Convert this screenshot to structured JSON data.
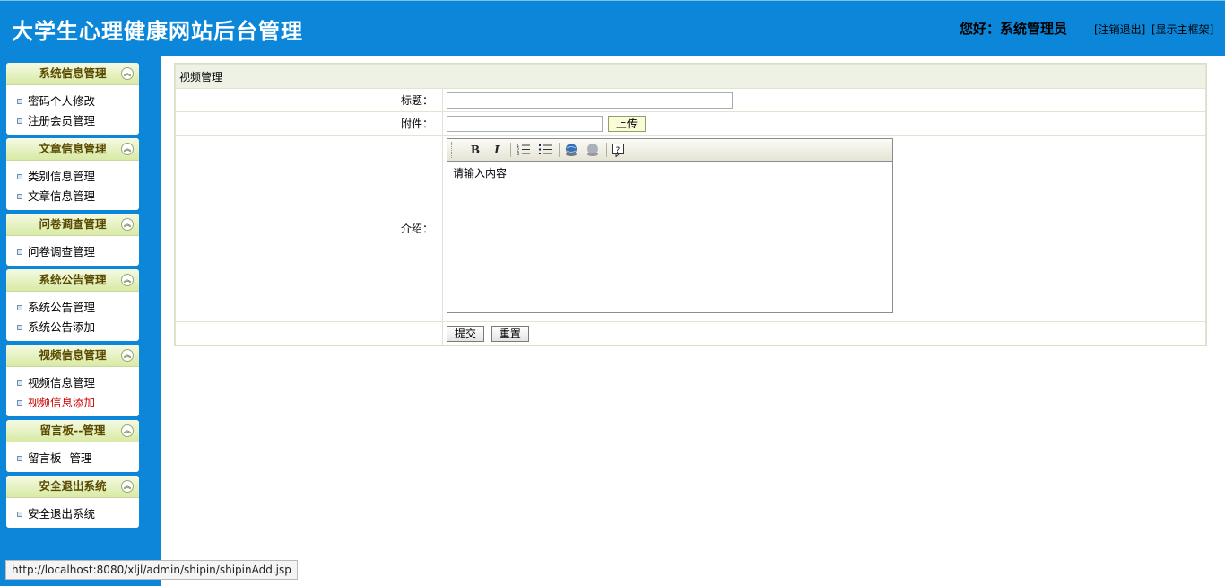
{
  "header": {
    "title": "大学生心理健康网站后台管理",
    "greeting": "您好：系统管理员",
    "logout": "[注销退出]",
    "show_frame": "[显示主框架]"
  },
  "sidebar": {
    "menus": [
      {
        "title": "系统信息管理",
        "items": [
          "密码个人修改",
          "注册会员管理"
        ]
      },
      {
        "title": "文章信息管理",
        "items": [
          "类别信息管理",
          "文章信息管理"
        ]
      },
      {
        "title": "问卷调查管理",
        "items": [
          "问卷调查管理"
        ]
      },
      {
        "title": "系统公告管理",
        "items": [
          "系统公告管理",
          "系统公告添加"
        ]
      },
      {
        "title": "视频信息管理",
        "items": [
          "视频信息管理",
          "视频信息添加"
        ]
      },
      {
        "title": "留言板--管理",
        "items": [
          "留言板--管理"
        ]
      },
      {
        "title": "安全退出系统",
        "items": [
          "安全退出系统"
        ]
      }
    ],
    "active_item": "视频信息添加"
  },
  "form": {
    "caption": "视频管理",
    "title_label": "标题：",
    "title_value": "",
    "file_label": "附件：",
    "file_value": "",
    "upload_button": "上传",
    "desc_label": "介绍：",
    "editor_placeholder": "请输入内容",
    "submit_button": "提交",
    "reset_button": "重置"
  },
  "editor_toolbar": {
    "bold": "B",
    "italic": "I",
    "icons": [
      "bold-icon",
      "italic-icon",
      "ordered-list-icon",
      "unordered-list-icon",
      "link-icon",
      "unlink-icon",
      "help-icon"
    ]
  },
  "statusbar": {
    "url": "http://localhost:8080/xljl/admin/shipin/shipinAdd.jsp"
  }
}
